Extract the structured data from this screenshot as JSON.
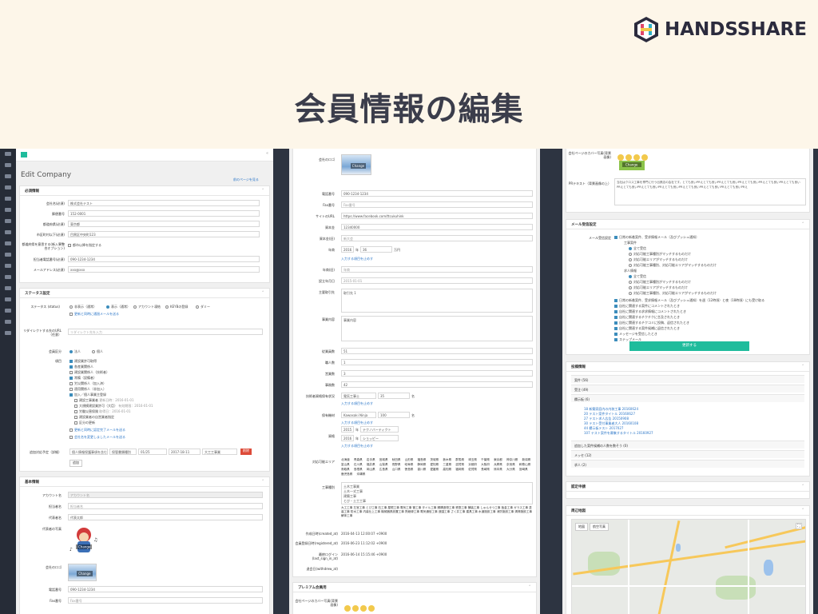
{
  "brand": {
    "name": "HANDSSHARE"
  },
  "page_title": "会員情報の編集",
  "panel1": {
    "header": "Edit Company",
    "back_link": "前のページを見る",
    "sec_required": "必須情報",
    "fields": [
      {
        "label": "会社名(必須)",
        "value": "株式会社テスト"
      },
      {
        "label": "郵便番号",
        "value": "152-0001"
      },
      {
        "label": "都道府県(必須)",
        "value": "東京都"
      },
      {
        "label": "市区町村以下(必須)",
        "value": "目黒区中央町123"
      },
      {
        "label": "都道府県を意思する(新入寮整合オプション)",
        "value": "都市以降を指定する"
      },
      {
        "label": "担当者電話番号(必須)",
        "value": "090-1234-1234"
      },
      {
        "label": "メールアドレス(必須)",
        "value": "xxx@xxx"
      }
    ],
    "sec_status": "ステータス設定",
    "status_label": "ステータス (status)",
    "status_options": [
      "非表示（通常）",
      "表示（通常）",
      "アカウント凍結",
      "KEYBの登録",
      "ダミー"
    ],
    "status_note": "更新と同時に通過メールを送る",
    "redirect_label": "リダイレクトする先のURL（任意）",
    "redirect_placeholder": "リダイレクト先を入力",
    "member_label": "会員区分",
    "member_options": [
      "法人",
      "個人"
    ],
    "checks_label": "項目",
    "checks": [
      "建設業許可取得",
      "各産業関係人",
      "建設業関係人（技術者）",
      "常備（設備者）",
      "労災関係人（加入済）",
      "適用関係人（非加入）",
      "加入／個人事業主登録",
      "建設工事業者",
      "大規模建設業許可（大臣）",
      "労働災害保険",
      "建設業者の自営業者指定",
      "区分の更新"
    ],
    "dates": [
      "更新日時：2016-01-01",
      "有効期限：2016-01-01",
      "取得日：2016-01-01"
    ],
    "link_update": "更新と同時に認定完了メールを送る",
    "link_company": "会社名を変更しましたメールを送る",
    "attach_label": "追加対応予定（詳細）",
    "attach_vals": [
      "個人情報保護事項を含む",
      "保管書類種別",
      "01/25",
      "2017-18-11",
      "大工工事業"
    ],
    "del_btn": "削除",
    "add_btn": "追加",
    "sec_basic": "基本情報",
    "account_label": "アカウント名",
    "account_value": "アカウント名",
    "rep_label": "担当者名",
    "rep_value": "担当者名",
    "ceo_label": "代表者名",
    "ceo_value": "代表太郎",
    "portrait_label": "代表者の写真",
    "logo_label": "会社のロゴ",
    "change": "Change",
    "phone_label": "電話番号",
    "phone_value": "090-1234-1234",
    "fax_label": "Fax番号",
    "fax_value": "Fax番号"
  },
  "panel2": {
    "logo_label": "会社のロゴ",
    "change": "Change",
    "fields": [
      {
        "label": "電話番号",
        "value": "090-1234-1234"
      },
      {
        "label": "Fax番号",
        "value": "Fax番号"
      },
      {
        "label": "サイトのURL",
        "value": "https://www.facebook.com/ttcukuhink"
      },
      {
        "label": "資本金",
        "value": "12340000"
      },
      {
        "label": "資本金(旧)",
        "value": "新大会"
      }
    ],
    "annual_label": "年商",
    "annual_vals": [
      "2016",
      "年",
      "36",
      "万円"
    ],
    "add_item": "入力する項目を止めす",
    "founded_label": "年商(旧)",
    "founded_value": "年商",
    "est_label": "設立年月日",
    "est_value": "2015-01-01",
    "biz_label": "主要取引先",
    "biz_value": "取引先 1",
    "content_label": "事業内容",
    "content_value": "事業内容",
    "emp_rows": [
      {
        "label": "従業員数",
        "value": "51"
      },
      {
        "label": "職人数",
        "value": "1"
      },
      {
        "label": "営業数",
        "value": "3"
      },
      {
        "label": "事務数",
        "value": "42"
      }
    ],
    "license_label": "技術者資格保有状況",
    "license_vals": [
      "電気工事士",
      "35",
      "名"
    ],
    "tech_label": "保有機材",
    "tech_vals": [
      "Kawasaki Ninja",
      "100",
      "名"
    ],
    "cert_label": "資格",
    "cert_vals": [
      "2015",
      "年",
      "テクノバーティクト",
      "2016",
      "年",
      "ショッピー"
    ],
    "area_label": "対応可能エリア",
    "area_grid": "北海道 青森県 岩手県 宮城県 秋田県 山形県 福島県 茨城県 栃木県 群馬県 埼玉県 千葉県 東京都 神奈川県 新潟県 富山県 石川県 福井県 山梨県 長野県 岐阜県 静岡県 愛知県 三重県 滋賀県 京都府 大阪府 兵庫県 奈良県 和歌山県 鳥取県 島根県 岡山県 広島県 山口県 徳島県 香川県 愛媛県 高知県 福岡県 佐賀県 長崎県 熊本県 大分県 宮崎県 鹿児島県 沖縄県",
    "trade_label": "工事種別",
    "trade_options": [
      "土木工事業",
      "土木一式工事",
      "建築工事",
      "とび・土工工事"
    ],
    "trade_text": "大工工事 左官工事 とび工事 石工事 屋根工事 電気工事 管工事 タイル工事 鋼構造物工事 鉄筋工事 舗装工事 しゅんせつ工事 板金工事 ガラス工事 塗装工事 防水工事 内装仕上工事 機械器具設置工事 熱絶縁工事 電気通信工事 造園工事 さく井工事 建具工事 水道施設工事 消防施設工事 清掃施設工事 解体工事",
    "created_label": "作成日時(created_at)",
    "created_value": "2016-04-13 12:00:07 +0900",
    "reg_label": "会員登録日時(registered_at)",
    "reg_value": "2016-06-23 11:12:02 +0900",
    "login_label": "最終ログイン(last_sign_in_at)",
    "login_value": "2016-06-14 15:15:46 +0900",
    "withdraw_label": "退会日(withdrew_at)",
    "premium_header": "プレミアム会員用",
    "cover_label": "会社ページのカバー写真(背景画像)"
  },
  "panel3": {
    "cover_label": "会社ページのカバー写真(背景画像)",
    "change": "Change",
    "pr_label": "PRテキスト（背景画像の上）",
    "pr_text": "当社はクロス工事を専門に行う出張店の会社です。とても良いPRえとても良いPRえとても良いPRえとても良いPRえとても良いPRえとても良いPRえとても良いPRえとても良いPRえとても良いPRえとても良いPRえとても良いPRえとても良いPRえ",
    "mail_header": "メール受信設定",
    "mail_label": "メール受信設定",
    "mail_items": [
      "日常の新着案件、受求情報メール（及びプッシュ通知）",
      "工事案件",
      "全て受信",
      "対応可能工事種別がマッチするものだけ",
      "対応可能エリアがマッチするものだけ",
      "対応可能工事種別、対応可能エリアがマッチするものだけ",
      "求人情報",
      "全て受信",
      "対応可能工事種別がマッチするものだけ",
      "対応可能エリアがマッチするものだけ",
      "対応可能工事種別、対応可能エリアがマッチするものだけ",
      "日常の新着案件、受求情報メール（及びプッシュ通知）を週（12時頃）と夜（18時頃）にも受け取る",
      "自社に関連する案件にコメントされたとき",
      "自社に関連する求求情報にコメントされたとき",
      "自社に関連するチクチクに言及されたとき",
      "自社に関連するチクコミに投稿、返信されたとき",
      "自社に関連する案件候補に返信されたとき",
      "メッセージを受信したとき",
      "ステップメール"
    ],
    "save_btn": "更新する",
    "related_header": "投稿情報",
    "related_rows": [
      "案件 (56)",
      "受注 (49)",
      "欄示板 (6)"
    ],
    "related_links": [
      "18 新築家庭内の内装工事 20160624",
      "20 テスト案件タイトル 20160627",
      "27 テスト求人広告 20150908",
      "30 テスト受付事業者大人 20160108",
      "44 欄示板テスト 2017027",
      "107 テスト案件を募集するタイトル 20160927"
    ],
    "related_more": [
      "追加した案件候補の人数を数そう (0)",
      "メッセ (12)",
      "求人 (2)"
    ],
    "approval_header": "認定申請",
    "map_header": "周辺地図",
    "map_tabs": [
      "地図",
      "航空写真"
    ]
  }
}
